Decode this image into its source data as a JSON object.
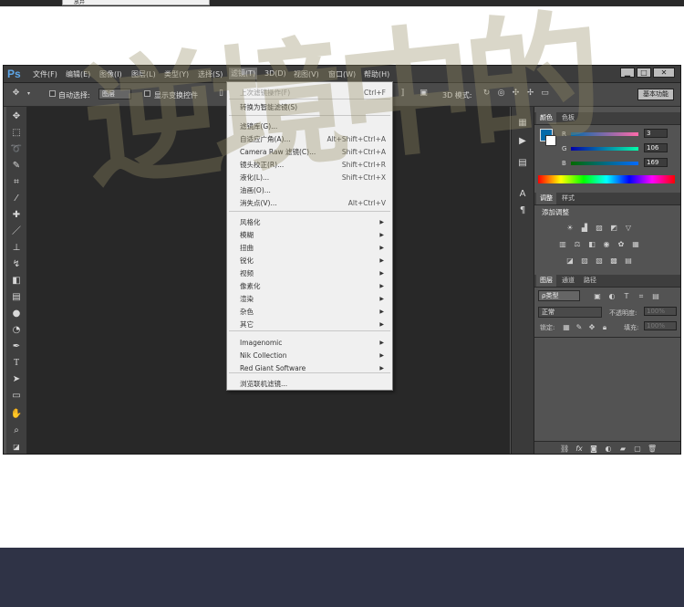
{
  "top_strip": {
    "menu_fragment": "放弃"
  },
  "watermark": {
    "text": "逆境中的"
  },
  "app": {
    "logo": "Ps"
  },
  "menubar": {
    "items": [
      "文件(F)",
      "编辑(E)",
      "图像(I)",
      "图层(L)",
      "类型(Y)",
      "选择(S)",
      "滤镜(T)",
      "3D(D)",
      "视图(V)",
      "窗口(W)",
      "帮助(H)"
    ],
    "window_buttons": [
      "▁",
      "□",
      "✕"
    ]
  },
  "options_bar": {
    "auto_select_label": "自动选择:",
    "auto_select_value": "图层",
    "show_transform_label": "显示变换控件",
    "mode_3d_label": "3D 模式:",
    "workspace": "基本功能"
  },
  "tools": [
    "move-tool-icon",
    "marquee-tool-icon",
    "lasso-tool-icon",
    "quick-select-tool-icon",
    "crop-tool-icon",
    "eyedropper-tool-icon",
    "healing-brush-icon",
    "brush-tool-icon",
    "clone-stamp-icon",
    "history-brush-icon",
    "eraser-tool-icon",
    "gradient-tool-icon",
    "blur-tool-icon",
    "dodge-tool-icon",
    "pen-tool-icon",
    "type-tool-icon",
    "path-select-icon",
    "rectangle-tool-icon",
    "hand-tool-icon",
    "zoom-tool-icon"
  ],
  "filter_menu": {
    "items": [
      {
        "label": "上次滤镜操作(F)",
        "shortcut": "Ctrl+F",
        "disabled": true
      },
      {
        "label": "转换为智能滤镜(S)",
        "shortcut": ""
      },
      {
        "label": "滤镜库(G)...",
        "shortcut": ""
      },
      {
        "label": "自适应广角(A)...",
        "shortcut": "Alt+Shift+Ctrl+A"
      },
      {
        "label": "Camera Raw 滤镜(C)...",
        "shortcut": "Shift+Ctrl+A"
      },
      {
        "label": "镜头校正(R)...",
        "shortcut": "Shift+Ctrl+R"
      },
      {
        "label": "液化(L)...",
        "shortcut": "Shift+Ctrl+X"
      },
      {
        "label": "油画(O)...",
        "shortcut": ""
      },
      {
        "label": "消失点(V)...",
        "shortcut": "Alt+Ctrl+V"
      },
      {
        "label": "风格化",
        "submenu": true
      },
      {
        "label": "模糊",
        "submenu": true
      },
      {
        "label": "扭曲",
        "submenu": true
      },
      {
        "label": "锐化",
        "submenu": true
      },
      {
        "label": "视频",
        "submenu": true
      },
      {
        "label": "像素化",
        "submenu": true
      },
      {
        "label": "渲染",
        "submenu": true
      },
      {
        "label": "杂色",
        "submenu": true
      },
      {
        "label": "其它",
        "submenu": true
      },
      {
        "label": "Imagenomic",
        "submenu": true
      },
      {
        "label": "Nik Collection",
        "submenu": true
      },
      {
        "label": "Red Giant Software",
        "submenu": true
      },
      {
        "label": "浏览联机滤镜...",
        "shortcut": ""
      }
    ]
  },
  "color_panel": {
    "tabs": [
      "颜色",
      "色板"
    ],
    "r_label": "R",
    "g_label": "G",
    "b_label": "B",
    "r": "3",
    "g": "106",
    "b": "169",
    "swatch_color": "#036aa9"
  },
  "adjustments_panel": {
    "tabs": [
      "调整",
      "样式"
    ],
    "title": "添加调整"
  },
  "layers_panel": {
    "tabs": [
      "图层",
      "通道",
      "路径"
    ],
    "kind_filter": "ρ类型",
    "blend_mode": "正常",
    "opacity_label": "不透明度:",
    "opacity_value": "100%",
    "lock_label": "锁定:",
    "fill_label": "填充:",
    "fill_value": "100%"
  }
}
